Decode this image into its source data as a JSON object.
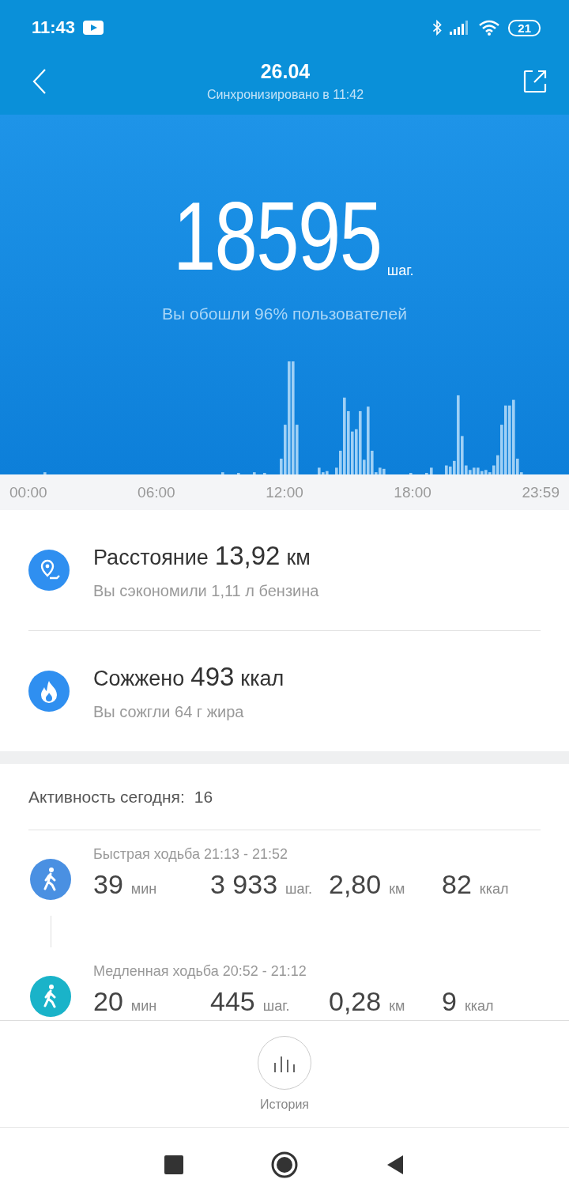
{
  "status_bar": {
    "time": "11:43",
    "battery": "21"
  },
  "header": {
    "title": "26.04",
    "subtitle": "Синхронизировано в 11:42"
  },
  "summary": {
    "steps": "18595",
    "unit": "шаг.",
    "comparison": "Вы обошли 96% пользователей"
  },
  "timeline": {
    "labels": [
      "00:00",
      "06:00",
      "12:00",
      "18:00",
      "23:59"
    ]
  },
  "stats": [
    {
      "kind": "distance",
      "label": "Расстояние",
      "value": "13,92",
      "unit": "км",
      "note": "Вы сэкономили 1,11 л бензина"
    },
    {
      "kind": "calories",
      "label": "Сожжено",
      "value": "493",
      "unit": "ккал",
      "note": "Вы сожгли 64 г жира"
    }
  ],
  "activity": {
    "label": "Активность сегодня:",
    "count": "16",
    "items": [
      {
        "title": "Быстрая ходьба 21:13 - 21:52",
        "color": "#4a90e2",
        "metrics": [
          {
            "value": "39",
            "unit": "мин"
          },
          {
            "value": "3 933",
            "unit": "шаг."
          },
          {
            "value": "2,80",
            "unit": "км"
          },
          {
            "value": "82",
            "unit": "ккал"
          }
        ]
      },
      {
        "title": "Медленная ходьба 20:52 - 21:12",
        "color": "#1ab3c9",
        "metrics": [
          {
            "value": "20",
            "unit": "мин"
          },
          {
            "value": "445",
            "unit": "шаг."
          },
          {
            "value": "0,28",
            "unit": "км"
          },
          {
            "value": "9",
            "unit": "ккал"
          }
        ]
      }
    ]
  },
  "history_button": {
    "label": "История"
  }
}
